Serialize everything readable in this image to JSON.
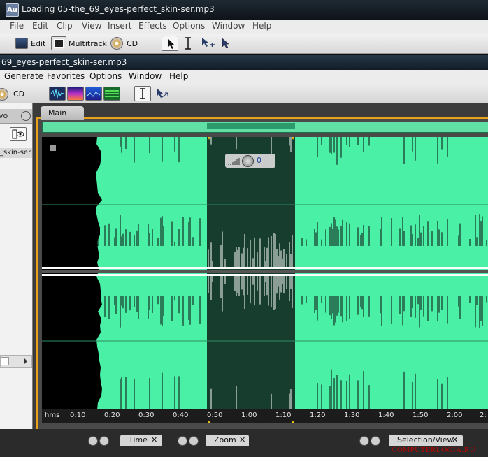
{
  "back_window": {
    "app_icon": "Au",
    "title": "Loading 05-the_69_eyes-perfect_skin-ser.mp3",
    "menu": [
      "File",
      "Edit",
      "Clip",
      "View",
      "Insert",
      "Effects",
      "Options",
      "Window",
      "Help"
    ],
    "toolbar": {
      "edit_label": "Edit",
      "multitrack_label": "Multitrack",
      "cd_label": "CD"
    }
  },
  "front_window": {
    "title": "69_eyes-perfect_skin-ser.mp3",
    "menu": [
      "Generate",
      "Favorites",
      "Options",
      "Window",
      "Help"
    ],
    "toolbar": {
      "cd_label": "CD"
    }
  },
  "left_panel": {
    "tab_label": "vo",
    "file_label": "_skin-ser"
  },
  "editor": {
    "tab_label": "Main",
    "volume_value": "0",
    "ruler_unit": "hms",
    "ruler_labels": [
      "0:10",
      "0:20",
      "0:30",
      "0:40",
      "0:50",
      "1:00",
      "1:10",
      "1:20",
      "1:30",
      "1:40",
      "1:50",
      "2:00",
      "2:"
    ]
  },
  "bottom_panels": {
    "time_tab": "Time",
    "zoom_tab": "Zoom",
    "selection_tab": "Selection/View"
  },
  "watermark": "COMPUTERLOGIA.RU",
  "colors": {
    "waveform": "#49f0a6",
    "selection": "#163d2d",
    "accent": "#e8a21a"
  }
}
